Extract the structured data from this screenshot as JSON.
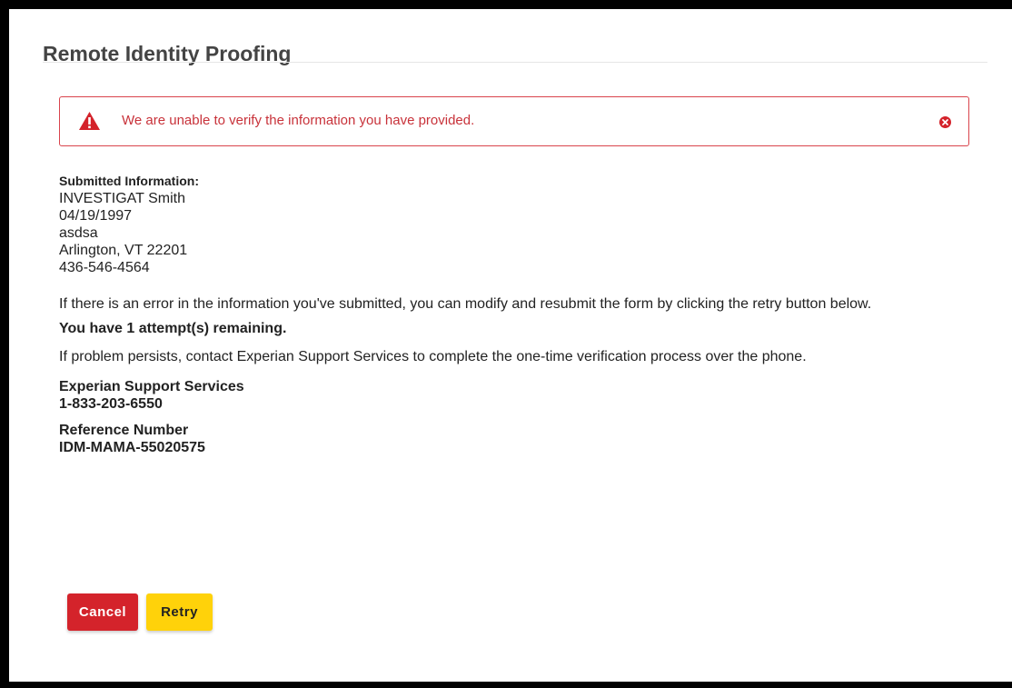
{
  "page": {
    "title": "Remote Identity Proofing"
  },
  "alert": {
    "message": "We are unable to verify the information you have provided.",
    "icon": "warning-triangle-icon",
    "close_icon": "close-circle-icon",
    "color": "#d9444c"
  },
  "submitted": {
    "label": "Submitted Information:",
    "lines": [
      "INVESTIGAT Smith",
      "04/19/1997",
      "asdsa",
      "Arlington, VT 22201",
      "436-546-4564"
    ]
  },
  "messages": {
    "error_hint": "If there is an error in the information you've submitted, you can modify and resubmit the form by clicking the retry button below.",
    "attempts": "You have 1 attempt(s) remaining.",
    "persist": "If problem persists, contact Experian Support Services to complete the one-time verification process over the phone."
  },
  "support": {
    "name": "Experian Support Services",
    "phone": "1-833-203-6550"
  },
  "reference": {
    "label": "Reference Number",
    "number": "IDM-MAMA-55020575"
  },
  "buttons": {
    "cancel_label": "Cancel",
    "retry_label": "Retry",
    "cancel_color": "#d4232b",
    "retry_color": "#ffd20a"
  }
}
